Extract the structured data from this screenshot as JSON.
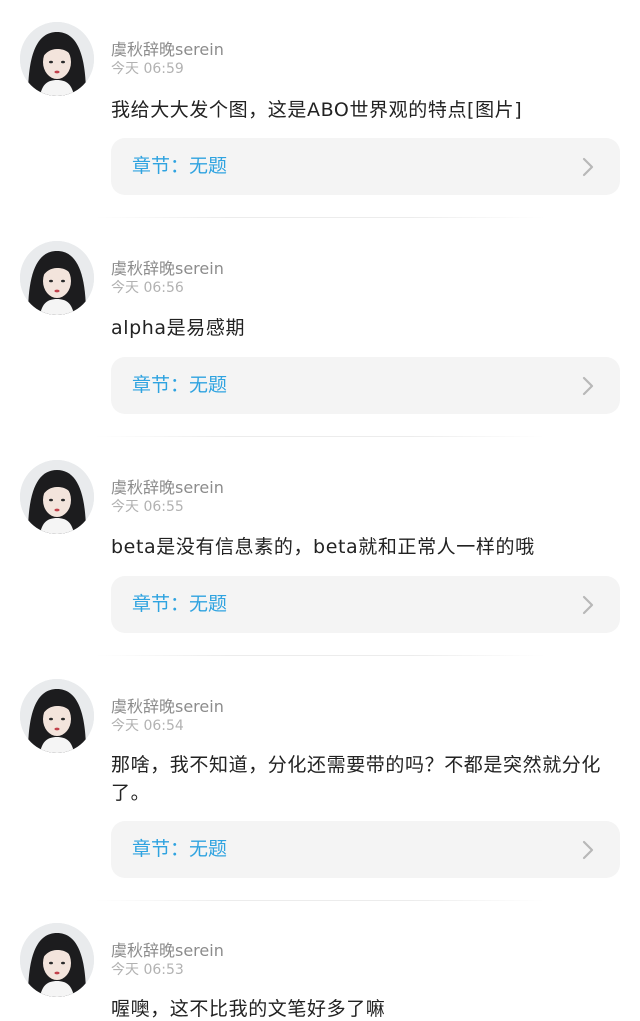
{
  "comments": [
    {
      "username": "虞秋辞晚serein",
      "time": "今天 06:59",
      "text": "我给大大发个图，这是ABO世界观的特点[图片]",
      "chapter_label": "章节：无题"
    },
    {
      "username": "虞秋辞晚serein",
      "time": "今天 06:56",
      "text": "alpha是易感期",
      "chapter_label": "章节：无题"
    },
    {
      "username": "虞秋辞晚serein",
      "time": "今天 06:55",
      "text": "beta是没有信息素的，beta就和正常人一样的哦",
      "chapter_label": "章节：无题"
    },
    {
      "username": "虞秋辞晚serein",
      "time": "今天 06:54",
      "text": "那啥，我不知道，分化还需要带的吗？不都是突然就分化了。",
      "chapter_label": "章节：无题"
    },
    {
      "username": "虞秋辞晚serein",
      "time": "今天 06:53",
      "text": "喔噢，这不比我的文笔好多了嘛",
      "chapter_label": ""
    }
  ],
  "colors": {
    "accent": "#2fa3e0",
    "card_background": "#f4f4f4",
    "username": "#8c8c8c",
    "time": "#b2b2b2",
    "text": "#222222"
  },
  "icons": {
    "avatar": "avatar",
    "chevron": "chevron-right-icon"
  }
}
